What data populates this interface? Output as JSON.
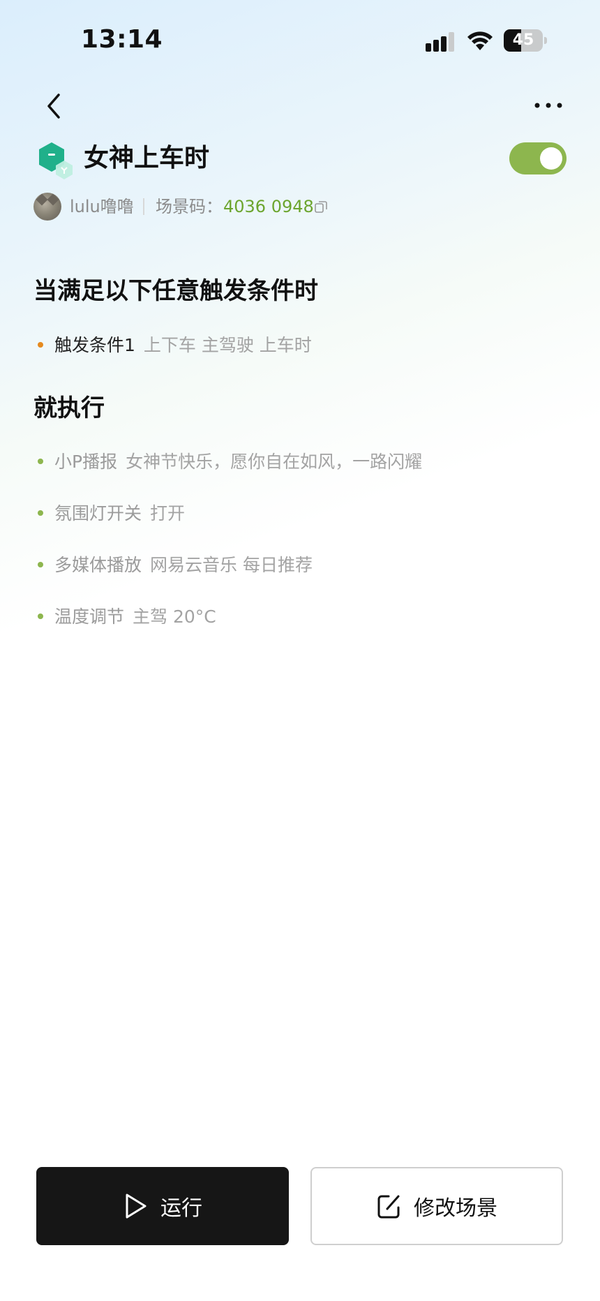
{
  "status_bar": {
    "time": "13:14",
    "battery_level": "45"
  },
  "header": {
    "title": "女神上车时",
    "toggle_on": true
  },
  "author": {
    "name": "lulu噜噜",
    "code_label": "场景码：",
    "code_value": "4036 0948"
  },
  "conditions": {
    "title": "当满足以下任意触发条件时",
    "items": [
      {
        "name": "触发条件1",
        "detail": "上下车 主驾驶 上车时"
      }
    ]
  },
  "actions": {
    "title": "就执行",
    "items": [
      {
        "name": "小P播报",
        "detail": "女神节快乐，愿你自在如风，一路闪耀"
      },
      {
        "name": "氛围灯开关",
        "detail": "打开"
      },
      {
        "name": "多媒体播放",
        "detail": "网易云音乐 每日推荐"
      },
      {
        "name": "温度调节",
        "detail": "主驾 20°C"
      }
    ]
  },
  "buttons": {
    "run_label": "运行",
    "edit_label": "修改场景"
  },
  "colors": {
    "accent_green": "#8db64e",
    "code_green": "#6ca52e",
    "condition_dot": "#e58a1f",
    "run_bg": "#161616"
  },
  "icons": [
    "back-icon",
    "more-icon",
    "scene-icon",
    "copy-icon",
    "play-icon",
    "edit-icon",
    "signal-icon",
    "wifi-icon",
    "battery-icon"
  ]
}
